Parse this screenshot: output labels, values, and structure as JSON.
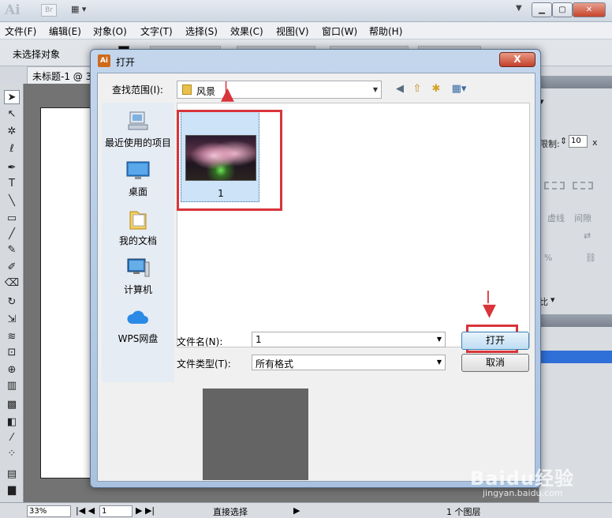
{
  "app": {
    "logo": "Ai",
    "bridge_badge": "Br",
    "menu": [
      "文件(F)",
      "编辑(E)",
      "对象(O)",
      "文字(T)",
      "选择(S)",
      "效果(C)",
      "视图(V)",
      "窗口(W)",
      "帮助(H)"
    ],
    "control_bar": {
      "selection_status": "未选择对象"
    },
    "document_tab": "未标题-1 @ 3",
    "right_panel": {
      "limit_label": "限制:",
      "limit_value": "10",
      "limit_unit": "x",
      "dash_label": "虚线",
      "gap_label": "间隙",
      "percent": "%",
      "ratio_fragment": "比"
    },
    "status_bar": {
      "zoom": "33%",
      "page": "1",
      "tool_status": "直接选择",
      "layers": "1 个图层"
    },
    "watermark": {
      "text": "Baidu经验",
      "sub": "jingyan.baidu.com"
    }
  },
  "dialog": {
    "app_icon": "Ai",
    "title": "打开",
    "close_label": "X",
    "look_in_label": "查找范围(I):",
    "look_in_value": "风景",
    "places": [
      {
        "label": "最近使用的项目",
        "icon": "recent-icon"
      },
      {
        "label": "桌面",
        "icon": "desktop-icon"
      },
      {
        "label": "我的文档",
        "icon": "documents-icon"
      },
      {
        "label": "计算机",
        "icon": "computer-icon"
      },
      {
        "label": "WPS网盘",
        "icon": "cloud-icon"
      }
    ],
    "files": [
      {
        "name": "1",
        "selected": true
      }
    ],
    "filename_label": "文件名(N):",
    "filename_value": "1",
    "filetype_label": "文件类型(T):",
    "filetype_value": "所有格式",
    "open_button": "打开",
    "cancel_button": "取消"
  },
  "colors": {
    "annotation_red": "#d8343a",
    "selection_blue": "#cce3f8",
    "dialog_frame": "#a9c2e0"
  }
}
